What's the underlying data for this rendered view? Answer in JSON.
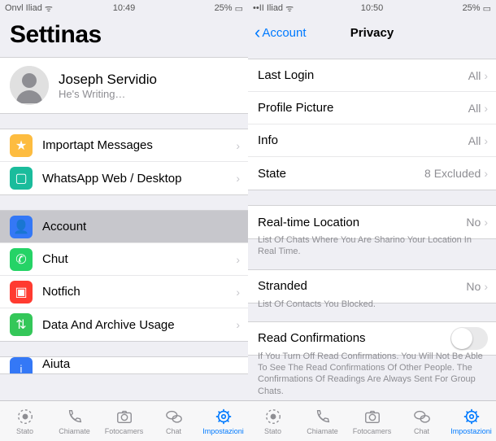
{
  "left": {
    "status": {
      "carrier": "Onvl Iliad",
      "wifi": "📶",
      "time": "10:49",
      "battery_pct": "25%",
      "battery_icon": "🔋"
    },
    "big_title": "Settinas",
    "profile": {
      "name": "Joseph Servidio",
      "sub": "He's Writing…"
    },
    "group1": {
      "starred": {
        "label": "Importapt Messages",
        "icon": "★"
      },
      "web": {
        "label": "WhatsApp Web / Desktop",
        "icon": "🖥"
      }
    },
    "group2": {
      "account": {
        "label": "Account",
        "icon": "🔑"
      },
      "chat": {
        "label": "Chut",
        "icon": "💬"
      },
      "notif": {
        "label": "Notfich",
        "icon": "🔔"
      },
      "data": {
        "label": "Data And Archive Usage",
        "icon": "↕"
      }
    },
    "group3": {
      "help": {
        "label": "Aiuta",
        "icon": "ℹ"
      }
    },
    "tabs": {
      "status": {
        "label": "Stato"
      },
      "calls": {
        "label": "Chiamate"
      },
      "camera": {
        "label": "Fotocamers"
      },
      "chat": {
        "label": "Chat"
      },
      "settings": {
        "label": "Impostazioni"
      }
    }
  },
  "right": {
    "status": {
      "carrier": "••II Iliad",
      "wifi": "📶",
      "time": "10:50",
      "battery_pct": "25%",
      "battery_icon": "🔋"
    },
    "nav": {
      "back": "Account",
      "title": "Privacy"
    },
    "group1": {
      "last_login": {
        "label": "Last Login",
        "value": "All"
      },
      "profile_pic": {
        "label": "Profile Picture",
        "value": "All"
      },
      "info": {
        "label": "Info",
        "value": "All"
      },
      "state": {
        "label": "State",
        "value": "8 Excluded"
      }
    },
    "group2": {
      "location": {
        "label": "Real-time Location",
        "value": "No"
      },
      "note": "List Of Chats Where You Are Sharino Your Location In Real Time."
    },
    "group3": {
      "blocked": {
        "label": "Stranded",
        "value": "No"
      },
      "note": "List Of Contacts You Blocked."
    },
    "group4": {
      "read": {
        "label": "Read Confirmations"
      },
      "note": "If You Turn Off Read Confirmations. You Will Not Be Able To See The Read Confirmations Of Other People. The Confirmations Of Readings Are Always Sent For Group Chats."
    },
    "tabs": {
      "status": {
        "label": "Stato"
      },
      "calls": {
        "label": "Chiamate"
      },
      "camera": {
        "label": "Fotocamers"
      },
      "chat": {
        "label": "Chat"
      },
      "settings": {
        "label": "Impostazioni"
      }
    }
  }
}
